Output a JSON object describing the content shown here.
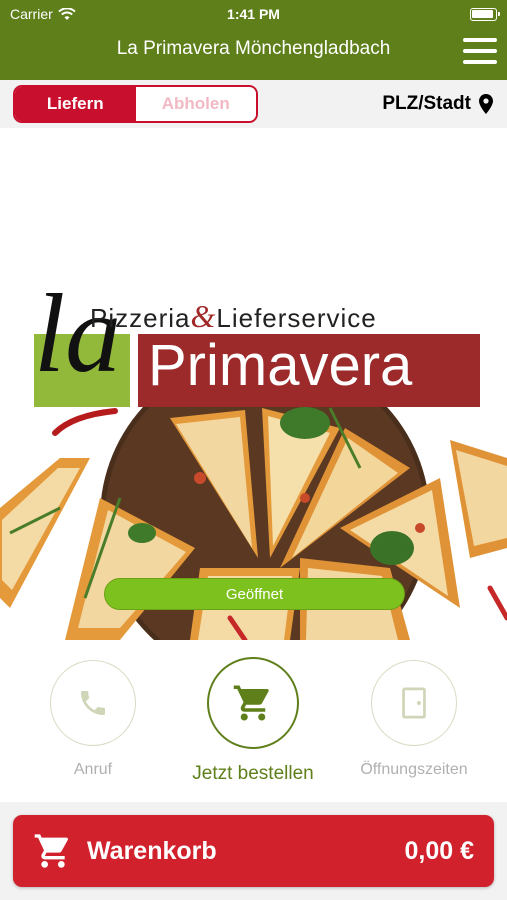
{
  "status_bar": {
    "carrier": "Carrier",
    "time": "1:41 PM"
  },
  "header": {
    "title": "La Primavera Mönchengladbach"
  },
  "mode": {
    "deliver": "Liefern",
    "pickup": "Abholen",
    "active": "deliver"
  },
  "location": {
    "label": "PLZ/Stadt"
  },
  "hero": {
    "logo_la": "la",
    "logo_subtitle_part1": "Pizzeria",
    "logo_amp": "&",
    "logo_subtitle_part2": "Lieferservice",
    "logo_name": "Primavera",
    "status": "Geöffnet"
  },
  "actions": {
    "call": "Anruf",
    "order": "Jetzt bestellen",
    "hours": "Öffnungszeiten"
  },
  "cart": {
    "label": "Warenkorb",
    "total": "0,00 €"
  },
  "colors": {
    "brand_green": "#5f7f1b",
    "brand_red": "#c8102e",
    "open_green": "#7dc11f"
  }
}
